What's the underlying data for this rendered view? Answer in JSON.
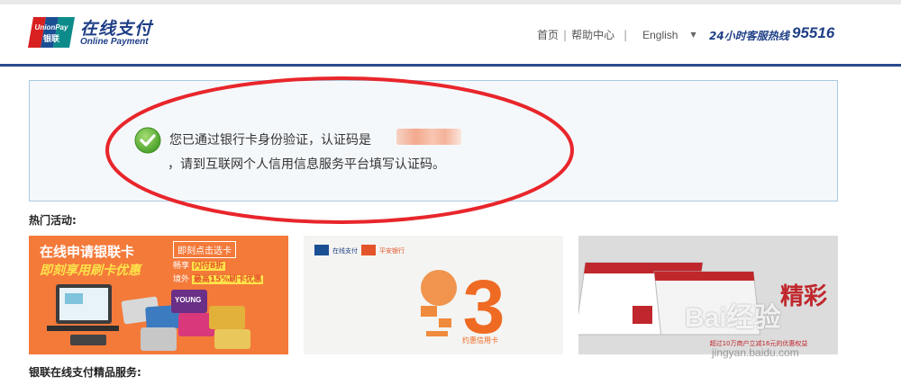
{
  "header": {
    "logo_cn": "在线支付",
    "logo_en": "Online Payment",
    "logo_mark_top": "UnionPay",
    "logo_mark_bottom": "银联",
    "nav": {
      "home": "首页",
      "help": "帮助中心",
      "language": "English"
    },
    "hotline_label": "24小时客服热线",
    "hotline_number": "95516"
  },
  "notice": {
    "line1": "您已通过银行卡身份验证，认证码是",
    "line2": "，请到互联网个人信用信息服务平台填写认证码。"
  },
  "sections": {
    "hot_activities": "热门活动:",
    "services": "银联在线支付精品服务:"
  },
  "banners": [
    {
      "title": "在线申请银联卡",
      "subtitle": "即刻享用刷卡优惠",
      "cta": "即刻点击选卡",
      "line1_prefix": "畅享",
      "line1_highlight": "闪付8折",
      "line2_prefix": "境外",
      "line2_highlight": "最高15%刷卡优惠",
      "card_label": "YOUNG"
    },
    {
      "brand1": "在线支付",
      "brand2": "平安银行",
      "big_number": "3",
      "caption": "约惠信用卡"
    },
    {
      "headline": "精彩",
      "footer": "超过10万商户立减16元的优惠权益"
    }
  ],
  "watermark": {
    "text": "Bai经验",
    "sub": "jingyan.baidu.com"
  },
  "colors": {
    "brand_blue": "#1f3f86",
    "notice_bg": "#f5f8fb",
    "notice_border": "#a9cbe0",
    "annotation_red": "#e8262b",
    "check_green": "#5fb336"
  }
}
